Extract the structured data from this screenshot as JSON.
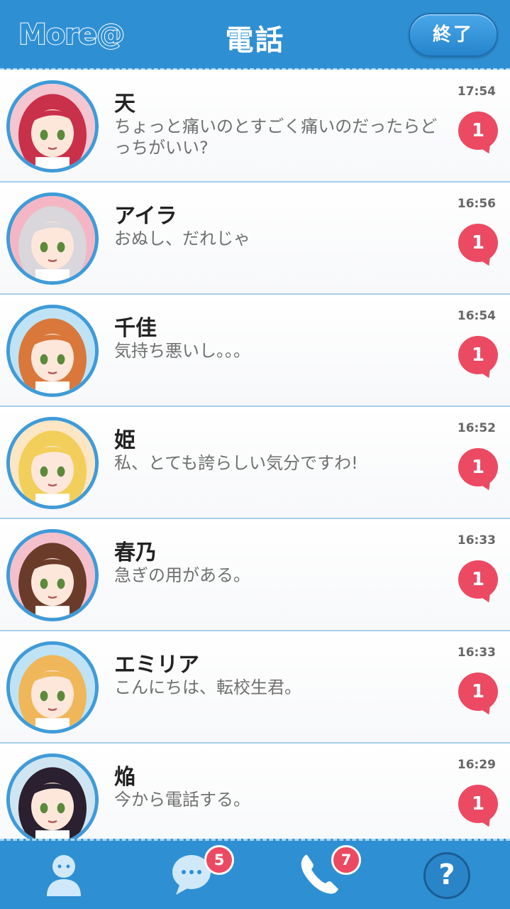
{
  "header": {
    "logo": "More@",
    "title": "電話",
    "end_label": "終了"
  },
  "calls": [
    {
      "name": "天",
      "message": "ちょっと痛いのとすごく痛いのだったらどっちがいい?",
      "time": "17:54",
      "unread": "1",
      "avatar_icon": "red-hair-girl-avatar",
      "hair": "#c9304a",
      "bg": "#f3c6d0"
    },
    {
      "name": "アイラ",
      "message": "おぬし、だれじゃ",
      "time": "16:56",
      "unread": "1",
      "avatar_icon": "silver-hair-girl-avatar",
      "hair": "#d9d6dc",
      "bg": "#f4b6c4"
    },
    {
      "name": "千佳",
      "message": "気持ち悪いし。。。",
      "time": "16:54",
      "unread": "1",
      "avatar_icon": "orange-hair-girl-avatar",
      "hair": "#d9783a",
      "bg": "#bfe3f5"
    },
    {
      "name": "姫",
      "message": "私、とても誇らしい気分ですわ!",
      "time": "16:52",
      "unread": "1",
      "avatar_icon": "blonde-girl-rose-avatar",
      "hair": "#f1cf5a",
      "bg": "#fde6c4"
    },
    {
      "name": "春乃",
      "message": "急ぎの用がある。",
      "time": "16:33",
      "unread": "1",
      "avatar_icon": "brown-hair-girl-avatar",
      "hair": "#6b3b2a",
      "bg": "#f3c0cc"
    },
    {
      "name": "エミリア",
      "message": "こんにちは、転校生君。",
      "time": "16:33",
      "unread": "1",
      "avatar_icon": "blonde-girl-avatar",
      "hair": "#efb75a",
      "bg": "#bfe3f5"
    },
    {
      "name": "焔",
      "message": "今から電話する。",
      "time": "16:29",
      "unread": "1",
      "avatar_icon": "hooded-girl-avatar",
      "hair": "#2a2030",
      "bg": "#cfe6f2"
    }
  ],
  "tabbar": {
    "chat_badge": "5",
    "phone_badge": "7",
    "help_label": "?"
  },
  "colors": {
    "primary": "#2f8fd3",
    "badge": "#ec4a62"
  }
}
